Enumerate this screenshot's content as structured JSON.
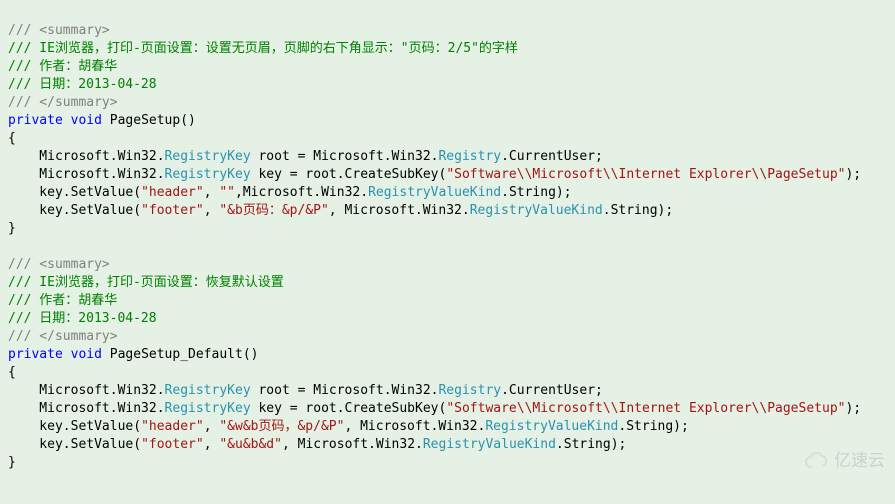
{
  "code": {
    "b1": {
      "sum_open": "/// <summary>",
      "desc": "/// IE浏览器，打印-页面设置：设置无页眉，页脚的右下角显示：\"页码：2/5\"的字样",
      "author": "/// 作者：胡春华",
      "date": "/// 日期：2013-04-28",
      "sum_close": "/// </summary>",
      "sig_priv": "private",
      "sig_void": "void",
      "sig_name": " PageSetup()",
      "brace_o": "{",
      "l1_a": "    Microsoft.Win32.",
      "l1_b": "RegistryKey",
      "l1_c": " root = Microsoft.Win32.",
      "l1_d": "Registry",
      "l1_e": ".CurrentUser;",
      "l2_a": "    Microsoft.Win32.",
      "l2_b": "RegistryKey",
      "l2_c": " key = root.CreateSubKey(",
      "l2_d": "\"Software\\\\Microsoft\\\\Internet Explorer\\\\PageSetup\"",
      "l2_e": ");",
      "l3_a": "    key.SetValue(",
      "l3_b": "\"header\"",
      "l3_c": ", ",
      "l3_d": "\"\"",
      "l3_e": ",Microsoft.Win32.",
      "l3_f": "RegistryValueKind",
      "l3_g": ".String);",
      "l4_a": "    key.SetValue(",
      "l4_b": "\"footer\"",
      "l4_c": ", ",
      "l4_d": "\"&b页码：&p/&P\"",
      "l4_e": ", Microsoft.Win32.",
      "l4_f": "RegistryValueKind",
      "l4_g": ".String);",
      "brace_c": "}"
    },
    "b2": {
      "sum_open": "/// <summary>",
      "desc": "/// IE浏览器，打印-页面设置：恢复默认设置",
      "author": "/// 作者：胡春华",
      "date": "/// 日期：2013-04-28",
      "sum_close": "/// </summary>",
      "sig_priv": "private",
      "sig_void": "void",
      "sig_name": " PageSetup_Default()",
      "brace_o": "{",
      "l1_a": "    Microsoft.Win32.",
      "l1_b": "RegistryKey",
      "l1_c": " root = Microsoft.Win32.",
      "l1_d": "Registry",
      "l1_e": ".CurrentUser;",
      "l2_a": "    Microsoft.Win32.",
      "l2_b": "RegistryKey",
      "l2_c": " key = root.CreateSubKey(",
      "l2_d": "\"Software\\\\Microsoft\\\\Internet Explorer\\\\PageSetup\"",
      "l2_e": ");",
      "l3_a": "    key.SetValue(",
      "l3_b": "\"header\"",
      "l3_c": ", ",
      "l3_d": "\"&w&b页码，&p/&P\"",
      "l3_e": ", Microsoft.Win32.",
      "l3_f": "RegistryValueKind",
      "l3_g": ".String);",
      "l4_a": "    key.SetValue(",
      "l4_b": "\"footer\"",
      "l4_c": ", ",
      "l4_d": "\"&u&b&d\"",
      "l4_e": ", Microsoft.Win32.",
      "l4_f": "RegistryValueKind",
      "l4_g": ".String);",
      "brace_c": "}"
    }
  },
  "watermark": "亿速云"
}
